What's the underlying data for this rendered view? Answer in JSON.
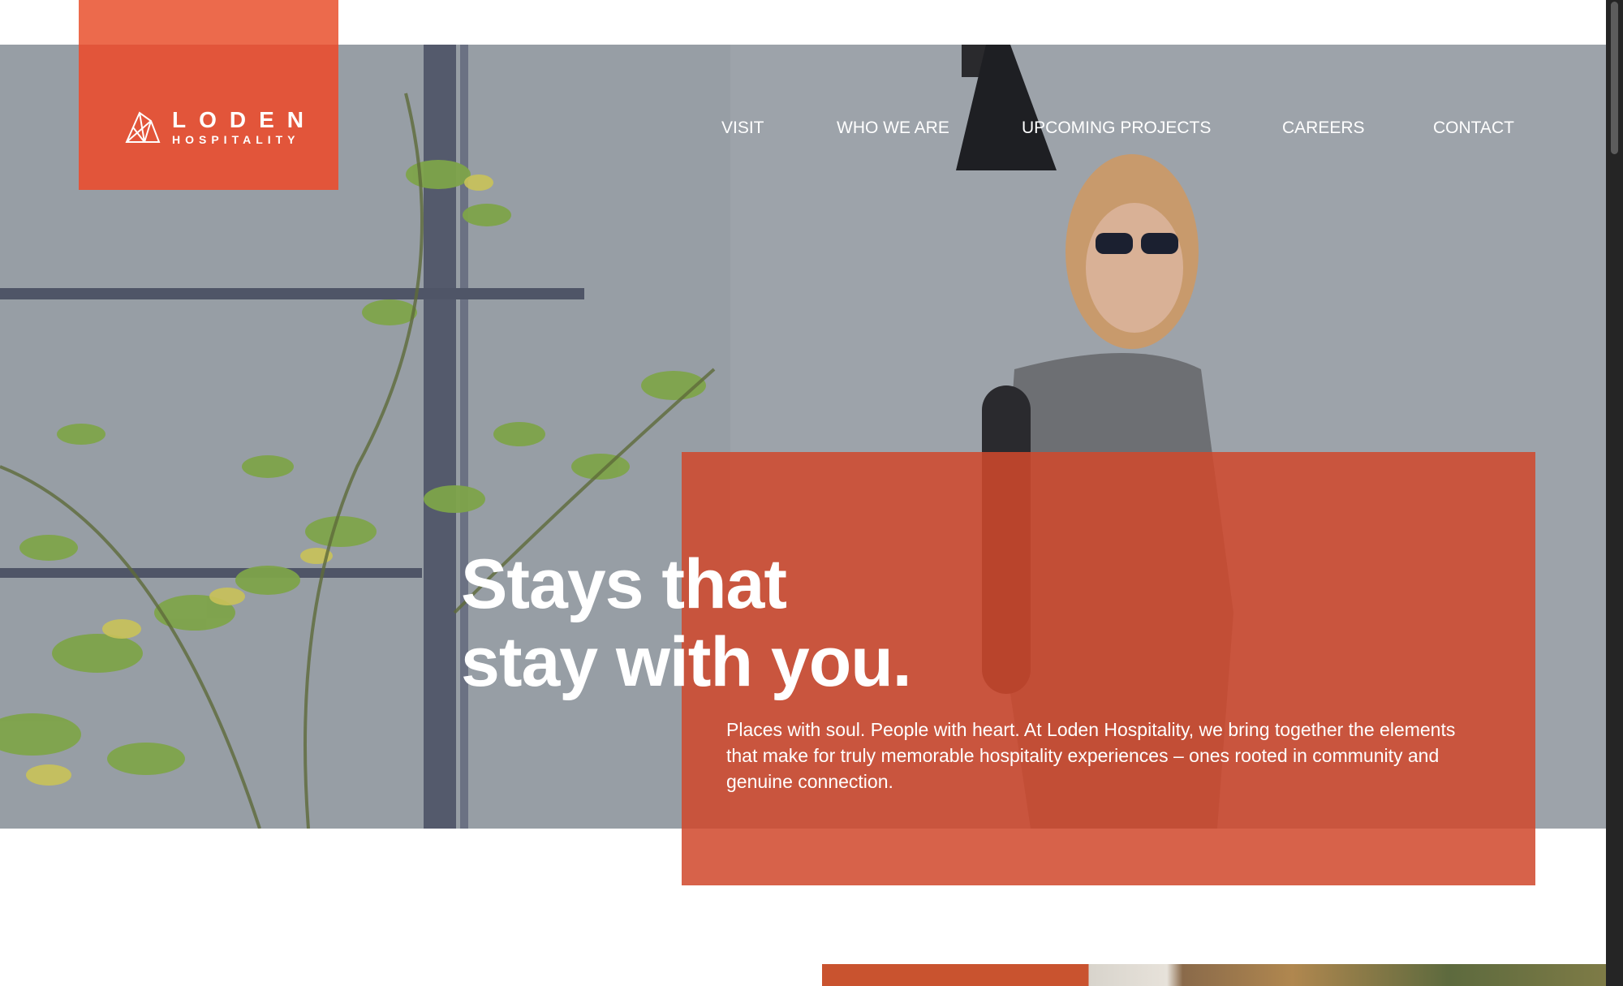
{
  "brand": {
    "name": "LODEN",
    "tagline": "HOSPITALITY",
    "logo_icon": "crystal-mountain-icon",
    "accent_color": "#e2553a",
    "panel_color": "#c8482c"
  },
  "nav": {
    "items": [
      {
        "label": "VISIT"
      },
      {
        "label": "WHO WE ARE"
      },
      {
        "label": "UPCOMING PROJECTS"
      },
      {
        "label": "CAREERS"
      },
      {
        "label": "CONTACT"
      }
    ]
  },
  "hero": {
    "headline_line1": "Stays that",
    "headline_line2": "stay with you.",
    "body": "Places with soul. People with heart. At Loden Hospitality, we bring together the elements that make for truly memorable hospitality experiences – ones rooted in community and genuine connection."
  }
}
